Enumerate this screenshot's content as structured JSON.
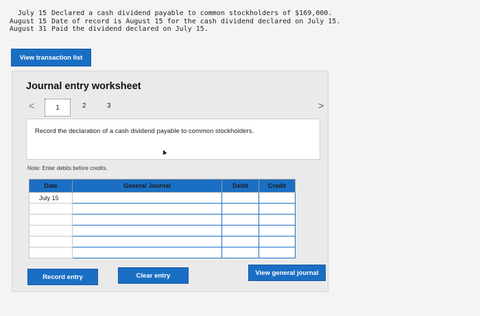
{
  "transactions": [
    {
      "date": "July 15",
      "text": "Declared a cash dividend payable to common stockholders of $169,000."
    },
    {
      "date": "August 15",
      "text": "Date of record is August 15 for the cash dividend declared on July 15."
    },
    {
      "date": "August 31",
      "text": "Paid the dividend declared on July 15."
    }
  ],
  "buttons": {
    "view_transaction_list": "View transaction list",
    "record_entry": "Record entry",
    "clear_entry": "Clear entry",
    "view_general_journal": "View general journal"
  },
  "worksheet": {
    "title": "Journal entry worksheet",
    "nav_prev": "<",
    "nav_next": ">",
    "steps": [
      "1",
      "2",
      "3"
    ],
    "instruction": "Record the declaration of a cash dividend payable to common stockholders.",
    "note": "Note: Enter debits before credits."
  },
  "journal": {
    "headers": {
      "date": "Date",
      "account": "General Journal",
      "debit": "Debit",
      "credit": "Credit"
    },
    "rows": [
      {
        "date": "July 15"
      },
      {
        "date": ""
      },
      {
        "date": ""
      },
      {
        "date": ""
      },
      {
        "date": ""
      },
      {
        "date": ""
      }
    ]
  },
  "colors": {
    "accent": "#1a6fc4"
  }
}
